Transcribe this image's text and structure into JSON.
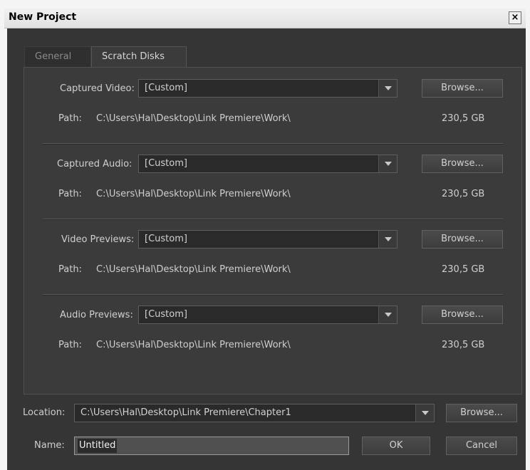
{
  "window": {
    "title": "New Project",
    "close_glyph": "×"
  },
  "tabs": [
    {
      "label": "General",
      "active": false
    },
    {
      "label": "Scratch Disks",
      "active": true
    }
  ],
  "scratch_disks": [
    {
      "label": "Captured Video:",
      "value": "[Custom]",
      "browse": "Browse...",
      "path_label": "Path:",
      "path": "C:\\Users\\Hal\\Desktop\\Link Premiere\\Work\\",
      "size": "230,5 GB"
    },
    {
      "label": "Captured Audio:",
      "value": "[Custom]",
      "browse": "Browse...",
      "path_label": "Path:",
      "path": "C:\\Users\\Hal\\Desktop\\Link Premiere\\Work\\",
      "size": "230,5 GB"
    },
    {
      "label": "Video Previews:",
      "value": "[Custom]",
      "browse": "Browse...",
      "path_label": "Path:",
      "path": "C:\\Users\\Hal\\Desktop\\Link Premiere\\Work\\",
      "size": "230,5 GB"
    },
    {
      "label": "Audio Previews:",
      "value": "[Custom]",
      "browse": "Browse...",
      "path_label": "Path:",
      "path": "C:\\Users\\Hal\\Desktop\\Link Premiere\\Work\\",
      "size": "230,5 GB"
    }
  ],
  "location": {
    "label": "Location:",
    "value": "C:\\Users\\Hal\\Desktop\\Link Premiere\\Chapter1",
    "browse": "Browse..."
  },
  "name": {
    "label": "Name:",
    "value": "Untitled"
  },
  "buttons": {
    "ok": "OK",
    "cancel": "Cancel"
  },
  "colors": {
    "dialog_bg": "#353535",
    "panel_bg": "#3b3b3b",
    "text": "#cfcfcf",
    "input_bg": "#2a2a2a"
  },
  "icons": {
    "dropdown": "chevron-down-icon",
    "close": "close-icon"
  }
}
